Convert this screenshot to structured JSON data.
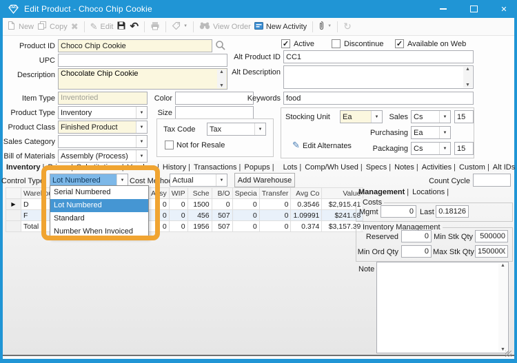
{
  "window": {
    "title": "Edit Product - Choco Chip Cookie"
  },
  "icons": {
    "pencil": "✎",
    "delete_x": "✖",
    "undo": "↶",
    "refresh": "↻",
    "caret_down": "▼",
    "check": "✓",
    "arrow_up": "▲",
    "arrow_down": "▼",
    "row_selector": "▶",
    "close": "✕"
  },
  "toolbar": {
    "new": "New",
    "copy": "Copy",
    "edit": "Edit",
    "view_order": "View Order",
    "new_activity": "New Activity"
  },
  "form": {
    "product_id_label": "Product ID",
    "product_id": "Choco Chip Cookie",
    "upc_label": "UPC",
    "upc": "",
    "description_label": "Description",
    "description": "Chocolate Chip Cookie",
    "active_label": "Active",
    "discontinue_label": "Discontinue",
    "available_on_web_label": "Available on Web",
    "alt_product_id_label": "Alt Product ID",
    "alt_product_id": "CC1",
    "alt_description_label": "Alt Description",
    "alt_description": "",
    "item_type_label": "Item Type",
    "item_type": "Inventoried",
    "product_type_label": "Product Type",
    "product_type": "Inventory",
    "product_class_label": "Product Class",
    "product_class": "Finished Product",
    "sales_category_label": "Sales Category",
    "sales_category": "",
    "bill_of_materials_label": "Bill of Materials",
    "bill_of_materials": "Assembly (Process)",
    "color_label": "Color",
    "color": "",
    "size_label": "Size",
    "size": "",
    "keywords_label": "Keywords",
    "keywords": "food",
    "tax_code_label": "Tax Code",
    "tax_code": "Tax",
    "not_for_resale_label": "Not for Resale",
    "stocking_unit_label": "Stocking Unit",
    "stocking_unit": "Ea",
    "edit_alternates_label": "Edit Alternates",
    "sales_label": "Sales",
    "sales_unit": "Cs",
    "sales_qty": "15",
    "purchasing_label": "Purchasing",
    "purchasing_unit": "Ea",
    "packaging_label": "Packaging",
    "packaging_unit": "Cs",
    "packaging_qty": "15"
  },
  "tabs": [
    "Inventory",
    "Prices",
    "Substitutions",
    "Vendors",
    "History",
    "Transactions",
    "Popups",
    "Lots",
    "Comp/Wh Used",
    "Specs",
    "Notes",
    "Activities",
    "Custom",
    "Alt IDs"
  ],
  "inventory": {
    "control_type_label": "Control Type",
    "control_type": "Lot Numbered",
    "cost_method_label": "Cost Method",
    "cost_method": "Actual",
    "add_warehouse": "Add Warehouse",
    "count_cycle_label": "Count Cycle",
    "count_cycle": "",
    "control_type_options": [
      "Serial Numbered",
      "Lot Numbered",
      "Standard",
      "Number When Invoiced"
    ],
    "selected_option": "Lot Numbered",
    "grid": {
      "headers": [
        "Warehouse",
        "Assy",
        "WIP",
        "Sche",
        "B/O",
        "Specia",
        "Transfer",
        "Avg Co",
        "Value"
      ],
      "rows": [
        {
          "cells": [
            "D",
            "0",
            "0",
            "1500",
            "0",
            "0",
            "0",
            "0.3546",
            "$2,915.41"
          ]
        },
        {
          "cells": [
            "F",
            "0",
            "0",
            "456",
            "507",
            "0",
            "0",
            "1.09991",
            "$241.98"
          ]
        },
        {
          "cells": [
            "Total",
            "0",
            "0",
            "1956",
            "507",
            "0",
            "0",
            "0.374",
            "$3,157.39"
          ]
        }
      ]
    }
  },
  "management": {
    "tab_management": "Management",
    "tab_locations": "Locations",
    "costs_legend": "Costs",
    "mgmt_label": "Mgmt",
    "mgmt_value": "0",
    "last_label": "Last",
    "last_value": "0.18126",
    "inv_mgmt_legend": "Inventory Management",
    "reserved_label": "Reserved",
    "reserved_value": "0",
    "min_stk_label": "Min Stk Qty",
    "min_stk_value": "500000",
    "min_ord_label": "Min Ord Qty",
    "min_ord_value": "0",
    "max_stk_label": "Max Stk Qty",
    "max_stk_value": "1500000",
    "note_label": "Note",
    "note_value": ""
  },
  "colors": {
    "titlebar": "#2095d5",
    "highlight_box": "#f0a431",
    "list_selection": "#4596d3",
    "field_cream": "#fbf7df"
  }
}
